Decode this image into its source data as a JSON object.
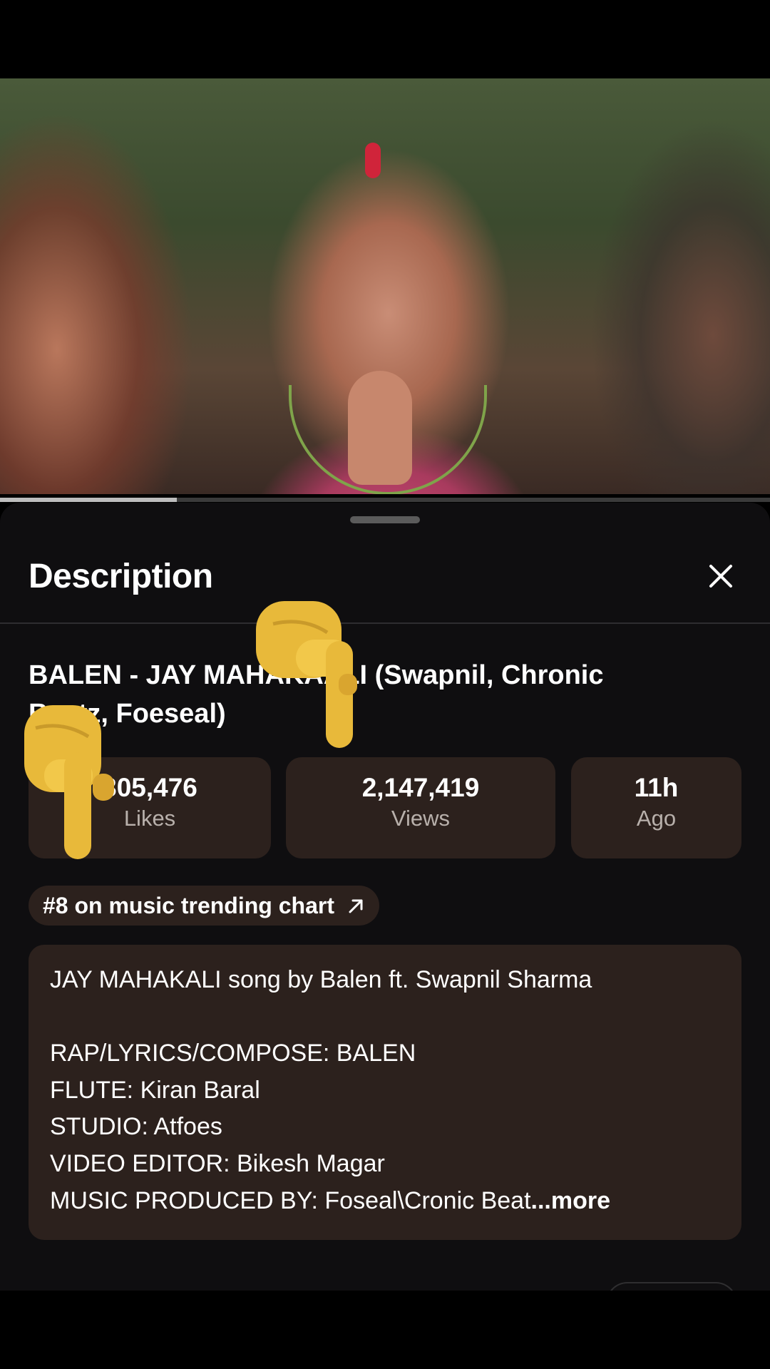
{
  "video": {
    "progress_fraction": 0.23
  },
  "sheet": {
    "title": "Description",
    "close_icon": "close-icon"
  },
  "video_title": {
    "line1": "BALEN - JAY MAHAKAALI (Swapnil, Chronic",
    "line2": "Beatz, Foeseal)"
  },
  "stats": [
    {
      "value": "305,476",
      "label": "Likes"
    },
    {
      "value": "2,147,419",
      "label": "Views"
    },
    {
      "value": "11h",
      "label": "Ago"
    }
  ],
  "trending": {
    "label": "#8 on music trending chart",
    "icon": "arrow-up-right-icon"
  },
  "description": {
    "lines": [
      "JAY MAHAKALI song by Balen ft. Swapnil Sharma",
      "RAP/LYRICS/COMPOSE: BALEN",
      "FLUTE: Kiran Baral",
      "STUDIO: Atfoes",
      "VIDEO EDITOR: Bikesh Magar",
      "MUSIC PRODUCED BY: Foseal\\Cronic Beat"
    ],
    "ellipsis": "...",
    "more_label": "more"
  },
  "overlay": {
    "emoji": "pointing-down-hand"
  },
  "colors": {
    "sheet_bg": "#0f0e10",
    "chip_bg": "#2c211d",
    "label_grey": "#b8b0ab"
  }
}
